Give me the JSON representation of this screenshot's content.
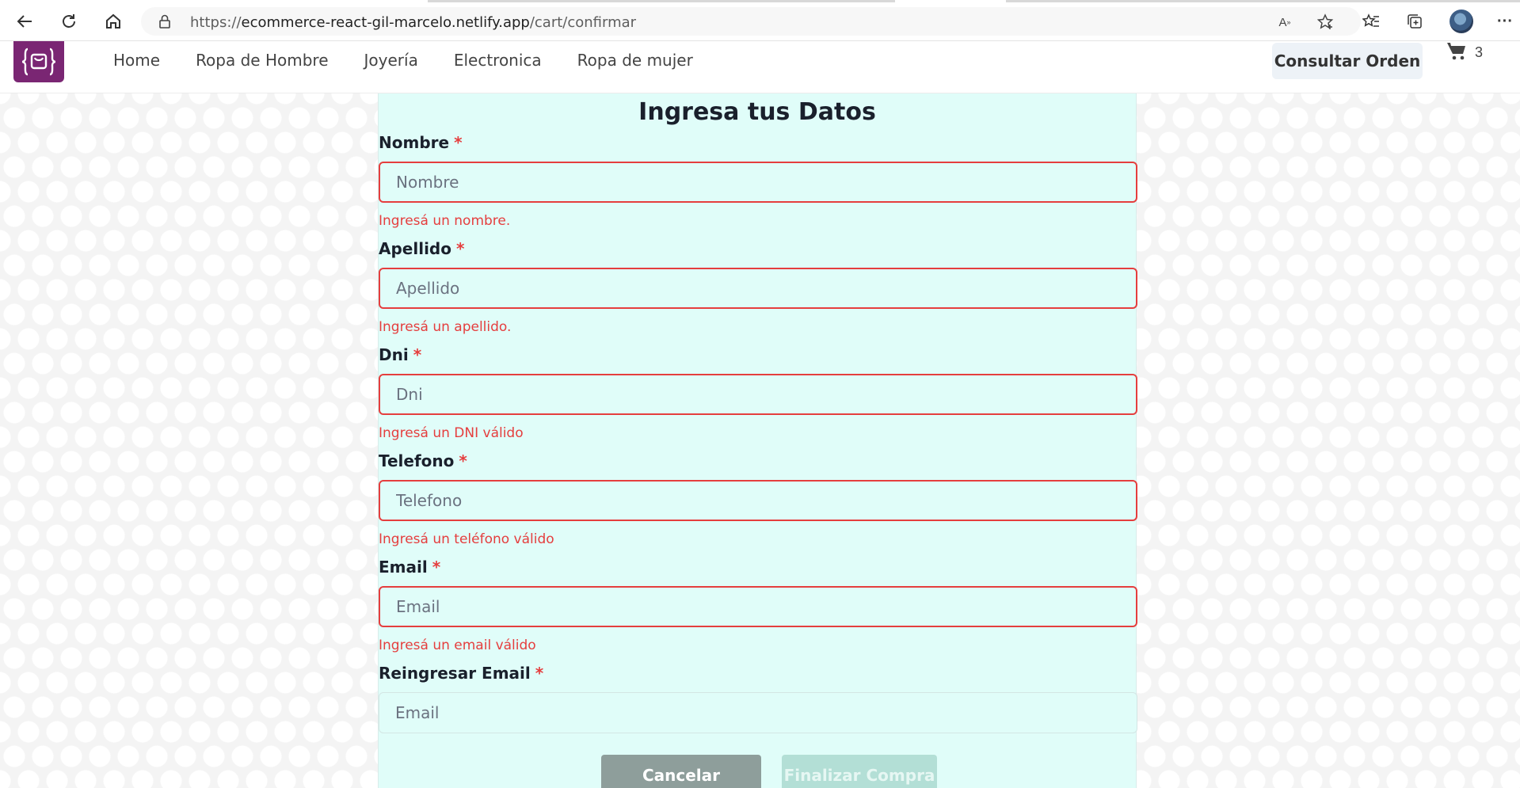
{
  "browser": {
    "url_prefix": "https://",
    "url_host": "ecommerce-react-gil-marcelo.netlify.app",
    "url_path": "/cart/confirmar"
  },
  "header": {
    "menu": [
      "Home",
      "Ropa de Hombre",
      "Joyería",
      "Electronica",
      "Ropa de mujer"
    ],
    "consult_button": "Consultar Orden",
    "cart_count": "3"
  },
  "form": {
    "title": "Ingresa tus Datos",
    "required_mark": "*",
    "fields": [
      {
        "label": "Nombre",
        "placeholder": "Nombre",
        "error": "Ingresá un nombre."
      },
      {
        "label": "Apellido",
        "placeholder": "Apellido",
        "error": "Ingresá un apellido."
      },
      {
        "label": "Dni",
        "placeholder": "Dni",
        "error": "Ingresá un DNI válido"
      },
      {
        "label": "Telefono",
        "placeholder": "Telefono",
        "error": "Ingresá un teléfono válido"
      },
      {
        "label": "Email",
        "placeholder": "Email",
        "error": "Ingresá un email válido"
      },
      {
        "label": "Reingresar Email",
        "placeholder": "Email",
        "error": ""
      }
    ],
    "cancel_button": "Cancelar",
    "finish_button": "Finalizar Compra"
  },
  "colors": {
    "brand": "#7a2673",
    "error": "#e53e3e",
    "card_bg": "#e0fdf9"
  }
}
